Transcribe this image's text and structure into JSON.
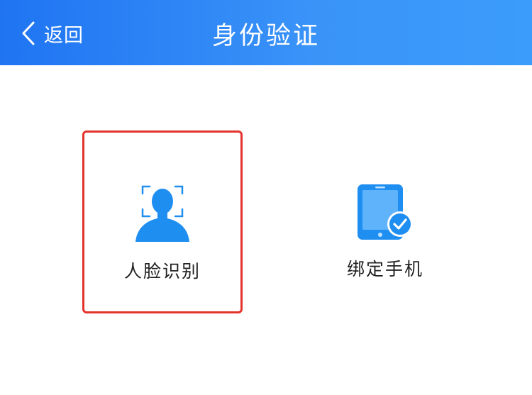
{
  "header": {
    "back_label": "返回",
    "title": "身份验证",
    "background": "#2a84f5"
  },
  "options": [
    {
      "label": "人脸识别",
      "icon": "face-recognition-icon",
      "selected": true
    },
    {
      "label": "绑定手机",
      "icon": "phone-verified-icon",
      "selected": false
    }
  ],
  "colors": {
    "accent": "#1f8ef1",
    "selection_border": "#e3332c",
    "label_text": "#222222"
  }
}
